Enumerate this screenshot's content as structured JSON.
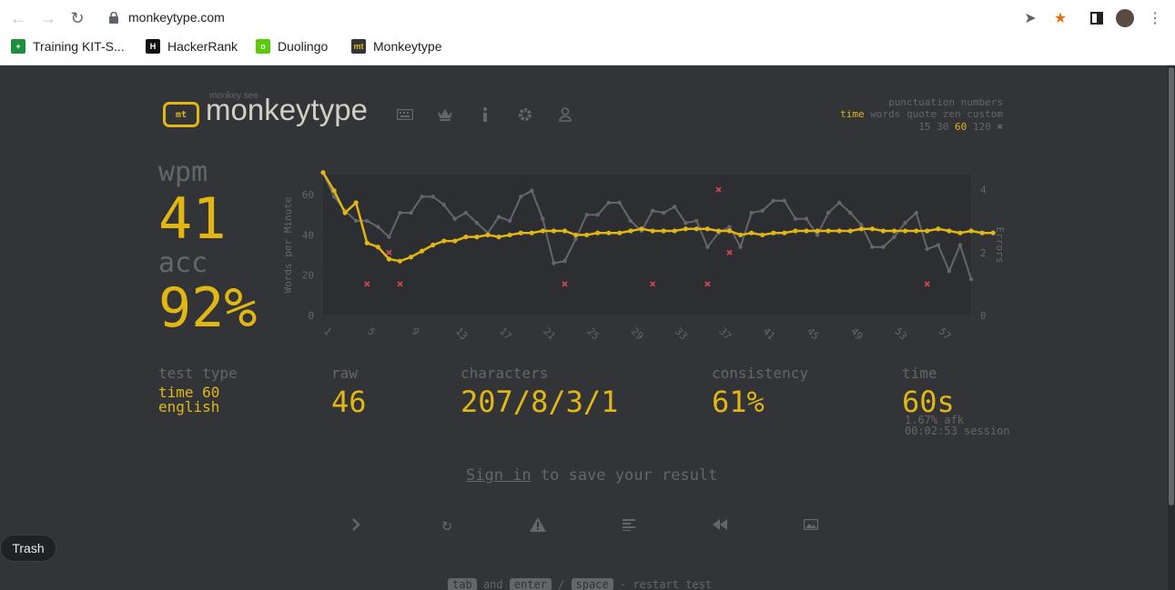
{
  "browser": {
    "url": "monkeytype.com",
    "bookmarks": [
      {
        "label": "Training KIT-S...",
        "icon": "green-plus-icon"
      },
      {
        "label": "HackerRank",
        "icon": "hackerrank-icon"
      },
      {
        "label": "Duolingo",
        "icon": "duolingo-icon"
      },
      {
        "label": "Monkeytype",
        "icon": "monkeytype-icon"
      }
    ]
  },
  "header": {
    "logo_small": "monkey see",
    "logo_text": "monkeytype",
    "nav_icons": [
      "keyboard-icon",
      "crown-icon",
      "info-icon",
      "gear-icon",
      "user-icon"
    ]
  },
  "config": {
    "line1": "punctuation numbers",
    "line2_active": "time",
    "line2_rest": "words quote zen custom",
    "line3_pre": "15 30",
    "line3_active": "60",
    "line3_post": "120"
  },
  "results": {
    "wpm_label": "wpm",
    "wpm": "41",
    "acc_label": "acc",
    "acc": "92%"
  },
  "stats": {
    "test_type_label": "test type",
    "test_type_1": "time 60",
    "test_type_2": "english",
    "raw_label": "raw",
    "raw": "46",
    "characters_label": "characters",
    "characters": "207/8/3/1",
    "consistency_label": "consistency",
    "consistency": "61%",
    "time_label": "time",
    "time": "60s",
    "afk": "1.67% afk",
    "session": "00:02:53 session"
  },
  "signin": {
    "link": "Sign in",
    "rest": " to save your result"
  },
  "actions": [
    "next-test-icon",
    "restart-icon",
    "report-icon",
    "words-history-icon",
    "replay-icon",
    "screenshot-icon"
  ],
  "footer": {
    "key1": "tab",
    "mid1": " and ",
    "key2": "enter",
    "mid2": " / ",
    "key3": "space",
    "tail": " - restart test"
  },
  "trash": "Trash",
  "chart_data": {
    "type": "line",
    "ylabel": "Words per Minute",
    "y2label": "Errors",
    "ylim": [
      0,
      70
    ],
    "y2lim": [
      0,
      4
    ],
    "yticks": [
      "0",
      "20",
      "40",
      "60"
    ],
    "y2ticks": [
      "0",
      "2",
      "4"
    ],
    "xticks": [
      "1",
      "5",
      "9",
      "13",
      "17",
      "21",
      "25",
      "29",
      "33",
      "37",
      "41",
      "45",
      "49",
      "53",
      "57"
    ],
    "colors": {
      "wpm": "#e2b714",
      "raw": "#646669",
      "errors": "#ca4754"
    },
    "series": [
      {
        "values": [
          71,
          62,
          51,
          56,
          36,
          34,
          28,
          27,
          29,
          32,
          35,
          37,
          37,
          39,
          39,
          40,
          39,
          40,
          41,
          41,
          42,
          42,
          42,
          40,
          40,
          41,
          41,
          41,
          42,
          43,
          42,
          42,
          42,
          43,
          43,
          43,
          42,
          42,
          40,
          41,
          40,
          41,
          41,
          42,
          42,
          42,
          42,
          42,
          42,
          43,
          43,
          42,
          42,
          42,
          42,
          42,
          43,
          42,
          41,
          42,
          41,
          41
        ]
      },
      {
        "values": [
          71,
          59,
          52,
          47,
          47,
          44,
          39,
          51,
          51,
          59,
          59,
          55,
          48,
          51,
          46,
          41,
          49,
          47,
          59,
          62,
          48,
          26,
          27,
          38,
          50,
          50,
          56,
          56,
          47,
          42,
          52,
          51,
          54,
          46,
          47,
          34,
          41,
          44,
          34,
          51,
          52,
          57,
          57,
          48,
          48,
          40,
          51,
          56,
          51,
          45,
          34,
          34,
          39,
          46,
          51,
          33,
          35,
          22,
          35,
          18
        ]
      }
    ],
    "errors": [
      {
        "x": 5,
        "y": 1
      },
      {
        "x": 7,
        "y": 2
      },
      {
        "x": 8,
        "y": 1
      },
      {
        "x": 23,
        "y": 1
      },
      {
        "x": 31,
        "y": 1
      },
      {
        "x": 36,
        "y": 1
      },
      {
        "x": 37,
        "y": 4
      },
      {
        "x": 38,
        "y": 2
      },
      {
        "x": 56,
        "y": 1
      }
    ]
  }
}
